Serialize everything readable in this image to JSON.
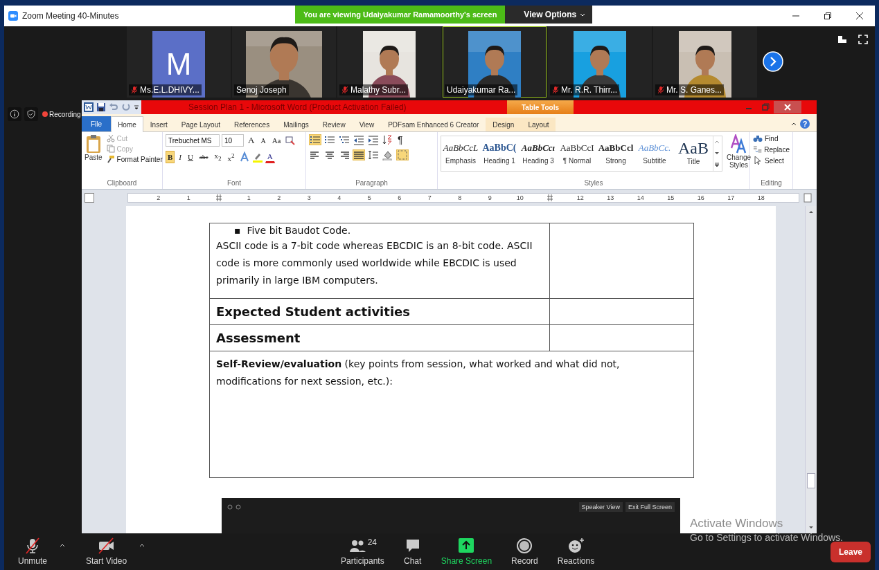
{
  "window": {
    "title": "Zoom Meeting 40-Minutes",
    "banner": "You are viewing Udaiyakumar Ramamoorthy's screen",
    "view_options": "View Options"
  },
  "participants": [
    {
      "name": "Ms.E.L.DHIVY...",
      "muted": true,
      "selected": false,
      "kind": "letter",
      "letter": "M"
    },
    {
      "name": "Senoj Joseph",
      "muted": false,
      "selected": false,
      "kind": "picture"
    },
    {
      "name": "Malathy Subr...",
      "muted": true,
      "selected": false,
      "kind": "picture"
    },
    {
      "name": "Udaiyakumar Ra...",
      "muted": false,
      "selected": true,
      "kind": "picture"
    },
    {
      "name": "Mr. R.R. Thirr...",
      "muted": true,
      "selected": false,
      "kind": "picture"
    },
    {
      "name": "Mr. S. Ganes...",
      "muted": true,
      "selected": false,
      "kind": "picture"
    }
  ],
  "recording": {
    "label": "Recording"
  },
  "word": {
    "title": "Session Plan 1 - Microsoft Word (Product Activation Failed)",
    "context_tab": "Table Tools",
    "help": "?",
    "tabs": [
      {
        "label": "File",
        "kind": "file",
        "selected": false
      },
      {
        "label": "Home",
        "kind": "normal",
        "selected": true
      },
      {
        "label": "Insert",
        "kind": "normal",
        "selected": false
      },
      {
        "label": "Page Layout",
        "kind": "normal",
        "selected": false
      },
      {
        "label": "References",
        "kind": "normal",
        "selected": false
      },
      {
        "label": "Mailings",
        "kind": "normal",
        "selected": false
      },
      {
        "label": "Review",
        "kind": "normal",
        "selected": false
      },
      {
        "label": "View",
        "kind": "normal",
        "selected": false
      },
      {
        "label": "PDFsam Enhanced 6 Creator",
        "kind": "normal",
        "selected": false
      },
      {
        "label": "Design",
        "kind": "context",
        "selected": false
      },
      {
        "label": "Layout",
        "kind": "context",
        "selected": false
      }
    ],
    "clipboard": {
      "label": "Clipboard",
      "paste": "Paste",
      "items": [
        {
          "label": "Cut",
          "kind": "cut",
          "disabled": true
        },
        {
          "label": "Copy",
          "kind": "copy",
          "disabled": true
        },
        {
          "label": "Format Painter",
          "kind": "painter",
          "disabled": false
        }
      ]
    },
    "font": {
      "label": "Font",
      "family": "Trebuchet MS",
      "size": "10",
      "grow": "A",
      "shrink": "A",
      "case": "Aa",
      "color_letter": "A",
      "styles": [
        {
          "label": "B",
          "selected": true
        },
        {
          "label": "I",
          "selected": false
        },
        {
          "label": "U",
          "selected": false
        },
        {
          "label": "abc",
          "selected": false
        },
        {
          "label": "x$_{2}$",
          "selected": false
        },
        {
          "label": "x$^{2}$",
          "selected": false
        }
      ]
    },
    "paragraph": {
      "label": "Paragraph",
      "pilcrow": "¶",
      "row1": [
        {
          "kind": "bullets",
          "selected": true
        },
        {
          "kind": "numbering",
          "selected": false
        },
        {
          "kind": "multilevel",
          "selected": false
        },
        {
          "kind": "outdent",
          "selected": false
        },
        {
          "kind": "indent",
          "selected": false
        },
        {
          "kind": "sort",
          "selected": false
        }
      ],
      "row2": [
        {
          "kind": "left",
          "selected": false
        },
        {
          "kind": "center",
          "selected": false
        },
        {
          "kind": "right",
          "selected": false
        },
        {
          "kind": "justify",
          "selected": true
        },
        {
          "kind": "spacing",
          "selected": false
        },
        {
          "kind": "shading",
          "selected": false
        },
        {
          "kind": "borders",
          "selected": true
        }
      ]
    },
    "styles": {
      "label": "Styles",
      "change": "Change Styles",
      "items": [
        {
          "sample": "AaBbCcL",
          "label": "Emphasis",
          "kind": "emphasis"
        },
        {
          "sample": "AaBbC(",
          "label": "Heading 1",
          "kind": "heading1"
        },
        {
          "sample": "AaBbCcı",
          "label": "Heading 3",
          "kind": "heading3"
        },
        {
          "sample": "AaBbCcI",
          "label": "¶ Normal",
          "kind": "normal"
        },
        {
          "sample": "AaBbCcl",
          "label": "Strong",
          "kind": "strong"
        },
        {
          "sample": "AaBbCc.",
          "label": "Subtitle",
          "kind": "subtitle"
        },
        {
          "sample": "AaB",
          "label": "Title",
          "kind": "title"
        }
      ]
    },
    "editing": {
      "label": "Editing",
      "items": [
        {
          "label": "Find",
          "kind": "find"
        },
        {
          "label": "Replace",
          "kind": "replace"
        },
        {
          "label": "Select",
          "kind": "select"
        }
      ]
    },
    "ruler": [
      {
        "kind": "num",
        "label": "2"
      },
      {
        "kind": "num",
        "label": "1"
      },
      {
        "kind": "col"
      },
      {
        "kind": "num",
        "label": "1"
      },
      {
        "kind": "num",
        "label": "2"
      },
      {
        "kind": "num",
        "label": "3"
      },
      {
        "kind": "num",
        "label": "4"
      },
      {
        "kind": "num",
        "label": "5"
      },
      {
        "kind": "num",
        "label": "6"
      },
      {
        "kind": "num",
        "label": "7"
      },
      {
        "kind": "num",
        "label": "8"
      },
      {
        "kind": "num",
        "label": "9"
      },
      {
        "kind": "num",
        "label": "10"
      },
      {
        "kind": "col"
      },
      {
        "kind": "num",
        "label": "12"
      },
      {
        "kind": "num",
        "label": "13"
      },
      {
        "kind": "num",
        "label": "14"
      },
      {
        "kind": "num",
        "label": "15"
      },
      {
        "kind": "num",
        "label": "16"
      },
      {
        "kind": "num",
        "label": "17"
      },
      {
        "kind": "num",
        "label": "18"
      }
    ],
    "table": {
      "bullet": "▪",
      "bullet_text": "Five bit Baudot Code.",
      "paragraph": "ASCII code is a 7-bit code whereas EBCDIC is an 8-bit code. ASCII code is more commonly used worldwide while EBCDIC is used primarily in large IBM computers.",
      "headings": [
        "Expected Student activities",
        "Assessment"
      ],
      "review": "**Self-Review/evaluation** (key points from session, what worked and what did not, modifications for next session, etc.):"
    },
    "inner_screen": {
      "buttons": [
        "Speaker View",
        "Exit Full Screen"
      ]
    }
  },
  "activation": {
    "title": "Activate Windows",
    "hint": "Go to Settings to activate Windows."
  },
  "toolbar": [
    {
      "label": "Unmute",
      "kind": "mic",
      "off": true
    },
    {
      "label": "Start Video",
      "kind": "video",
      "off": true
    },
    {
      "label": "Participants",
      "kind": "participants",
      "count": "24"
    },
    {
      "label": "Chat",
      "kind": "chat"
    },
    {
      "label": "Share Screen",
      "kind": "share"
    },
    {
      "label": "Record",
      "kind": "record"
    },
    {
      "label": "Reactions",
      "kind": "reactions"
    }
  ],
  "leave": "Leave"
}
